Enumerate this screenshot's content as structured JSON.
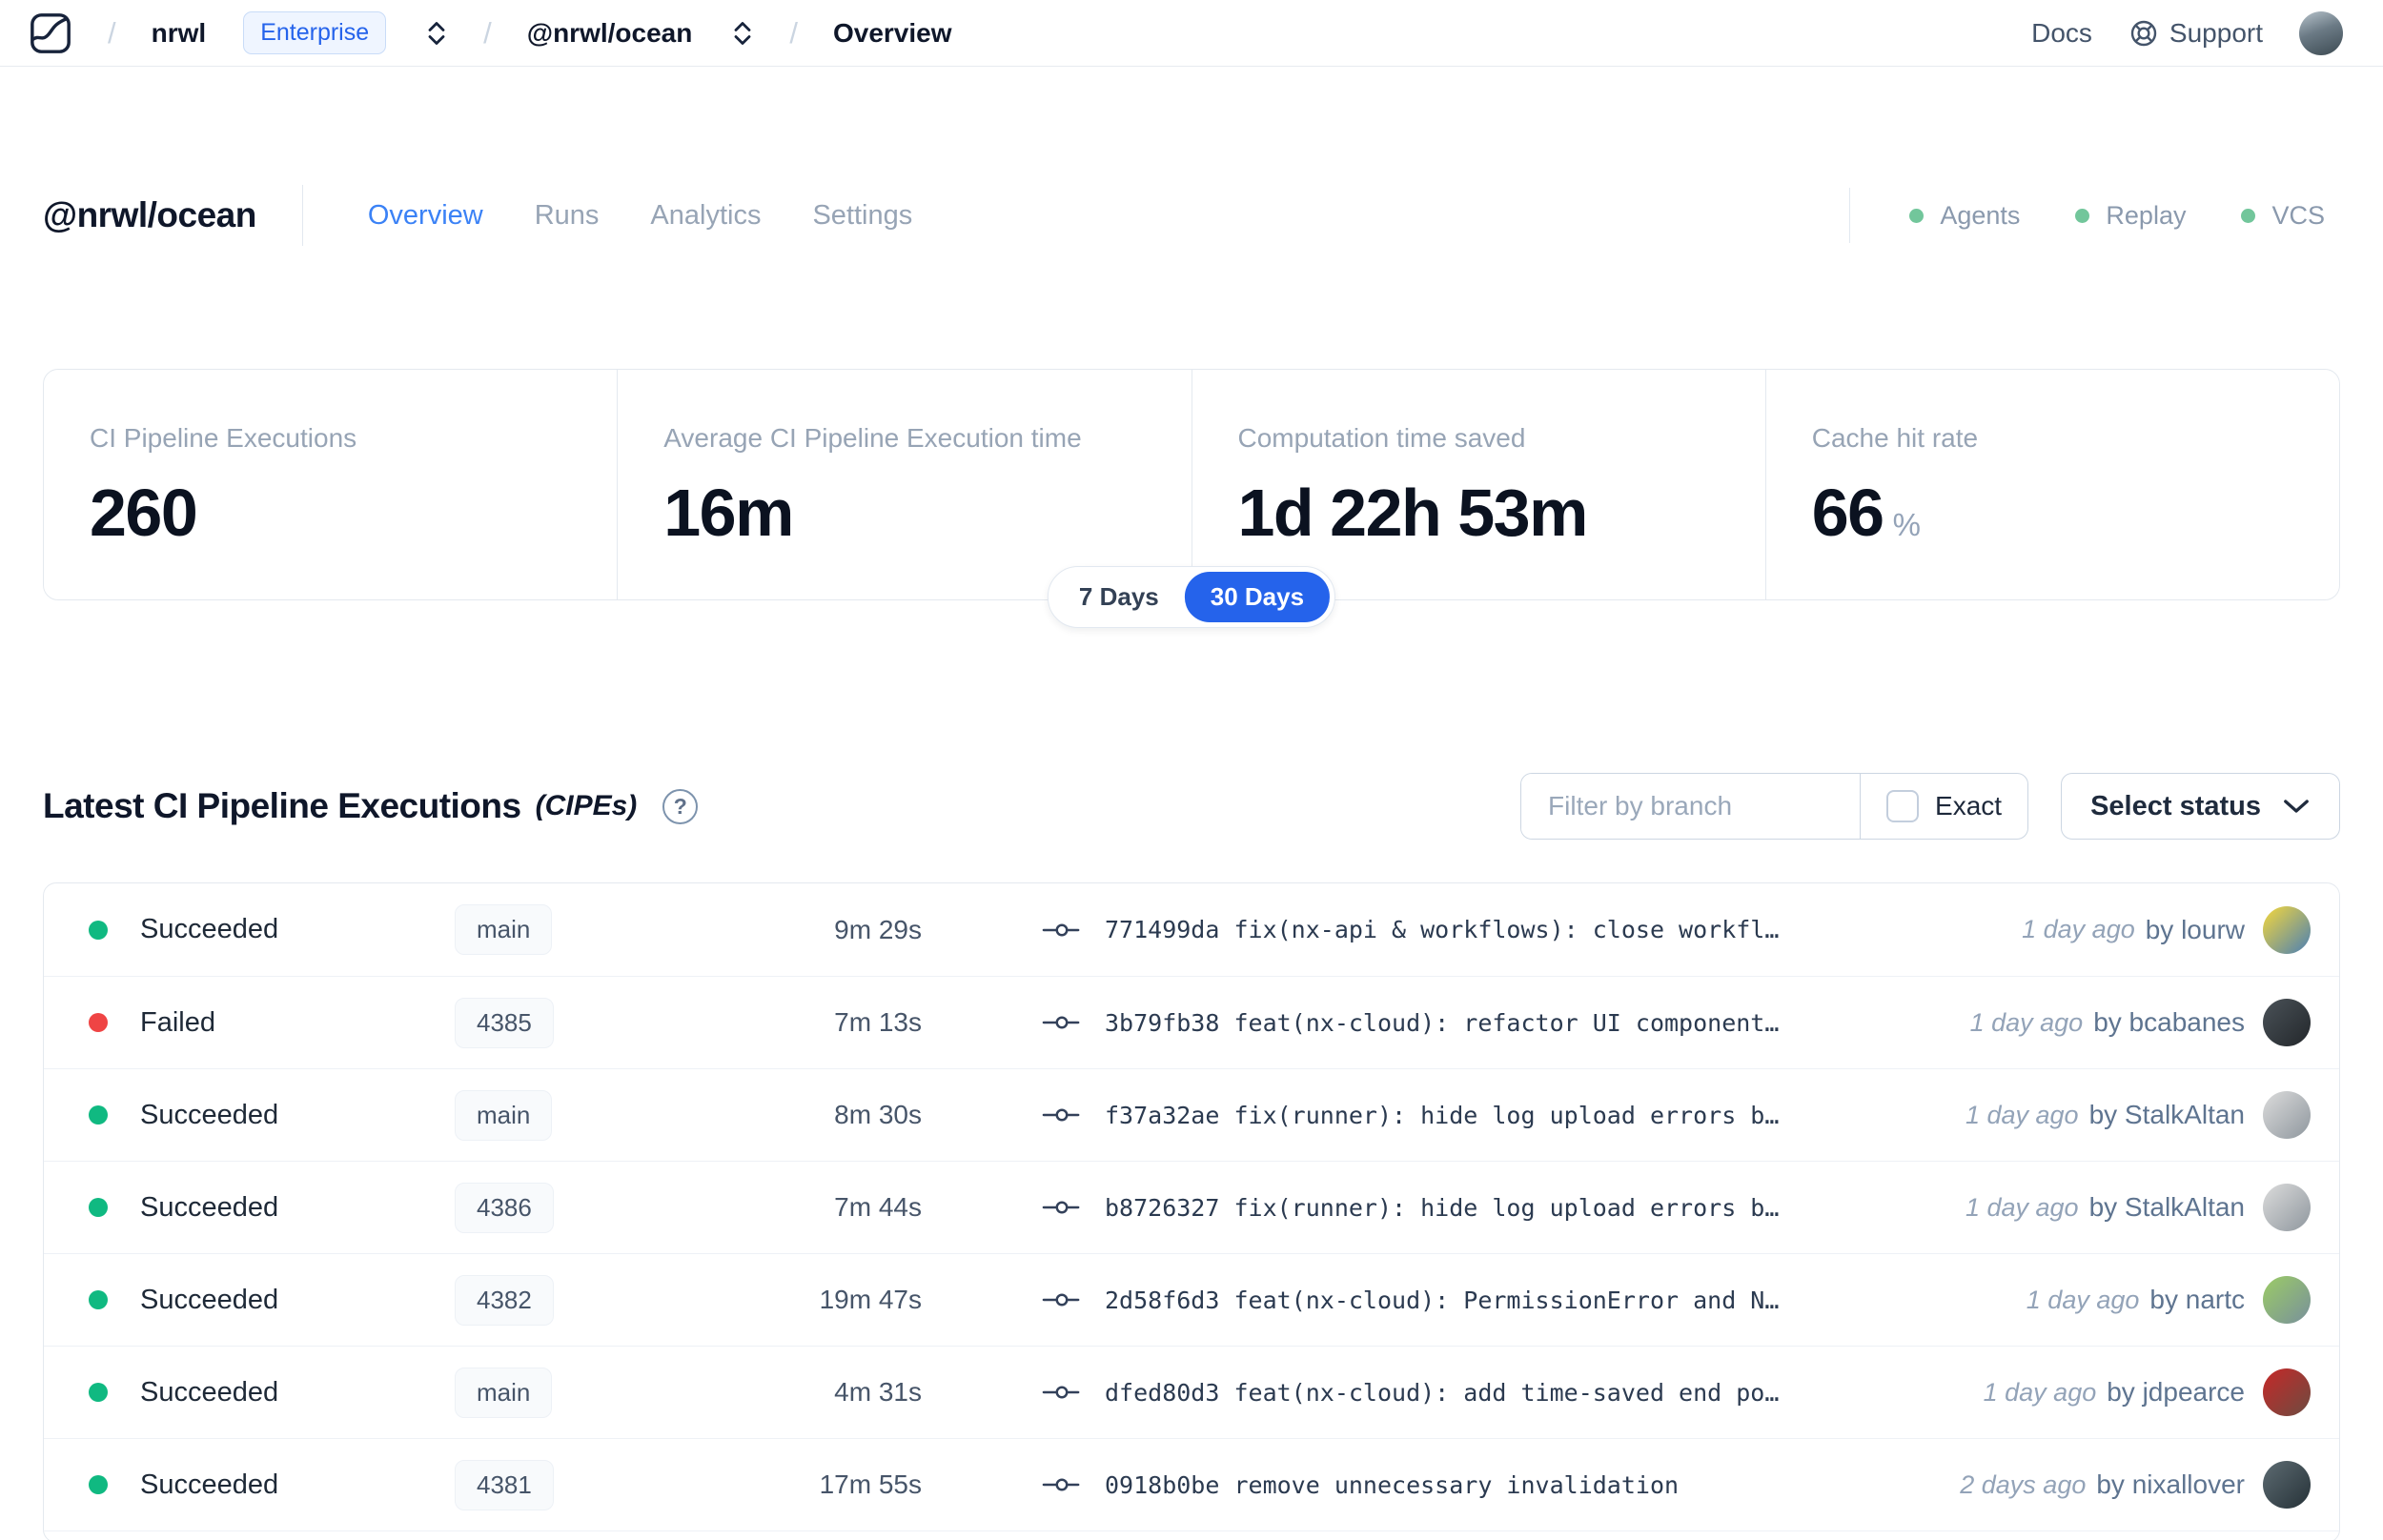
{
  "navbar": {
    "breadcrumb": {
      "separator": "/",
      "org": "nrwl",
      "org_badge": "Enterprise",
      "workspace": "@nrwl/ocean",
      "page": "Overview"
    },
    "docs_label": "Docs",
    "support_label": "Support"
  },
  "page_header": {
    "title": "@nrwl/ocean",
    "tabs": [
      {
        "label": "Overview",
        "active": true
      },
      {
        "label": "Runs",
        "active": false
      },
      {
        "label": "Analytics",
        "active": false
      },
      {
        "label": "Settings",
        "active": false
      }
    ],
    "feature_statuses": [
      {
        "label": "Agents",
        "color": "#72c69b"
      },
      {
        "label": "Replay",
        "color": "#72c69b"
      },
      {
        "label": "VCS",
        "color": "#72c69b"
      }
    ]
  },
  "stats": {
    "cards": [
      {
        "label": "CI Pipeline Executions",
        "value": "260",
        "unit": ""
      },
      {
        "label": "Average CI Pipeline Execution time",
        "value": "16m",
        "unit": ""
      },
      {
        "label": "Computation time saved",
        "value": "1d 22h 53m",
        "unit": ""
      },
      {
        "label": "Cache hit rate",
        "value": "66",
        "unit": "%"
      }
    ],
    "period_toggle": {
      "options": [
        "7 Days",
        "30 Days"
      ],
      "selected": "30 Days",
      "active_color": "#2563eb"
    }
  },
  "cipes": {
    "title": "Latest CI Pipeline Executions",
    "title_suffix": "(CIPEs)",
    "help_icon": "?",
    "filter": {
      "placeholder": "Filter by branch",
      "exact_label": "Exact",
      "checkbox_checked": false
    },
    "status_select_label": "Select status",
    "rows": [
      {
        "status": "Succeeded",
        "status_color": "#10b981",
        "branch": "main",
        "duration": "9m 29s",
        "commit": "771499da fix(nx-api & workflows): close workfl…",
        "time": "1 day ago",
        "author": "by lourw",
        "avatar_colors": [
          "#f6d83b",
          "#4a7fb5"
        ]
      },
      {
        "status": "Failed",
        "status_color": "#ef4444",
        "branch": "4385",
        "duration": "7m 13s",
        "commit": "3b79fb38 feat(nx-cloud): refactor UI component…",
        "time": "1 day ago",
        "author": "by bcabanes",
        "avatar_colors": [
          "#4a5258",
          "#23272b"
        ]
      },
      {
        "status": "Succeeded",
        "status_color": "#10b981",
        "branch": "main",
        "duration": "8m 30s",
        "commit": "f37a32ae fix(runner): hide log upload errors b…",
        "time": "1 day ago",
        "author": "by StalkAltan",
        "avatar_colors": [
          "#dcdcdc",
          "#8f979e"
        ]
      },
      {
        "status": "Succeeded",
        "status_color": "#10b981",
        "branch": "4386",
        "duration": "7m 44s",
        "commit": "b8726327 fix(runner): hide log upload errors b…",
        "time": "1 day ago",
        "author": "by StalkAltan",
        "avatar_colors": [
          "#dcdcdc",
          "#8f979e"
        ]
      },
      {
        "status": "Succeeded",
        "status_color": "#10b981",
        "branch": "4382",
        "duration": "19m 47s",
        "commit": "2d58f6d3 feat(nx-cloud): PermissionError and N…",
        "time": "1 day ago",
        "author": "by nartc",
        "avatar_colors": [
          "#9ccc65",
          "#78909c"
        ]
      },
      {
        "status": "Succeeded",
        "status_color": "#10b981",
        "branch": "main",
        "duration": "4m 31s",
        "commit": "dfed80d3 feat(nx-cloud): add time-saved end po…",
        "time": "1 day ago",
        "author": "by jdpearce",
        "avatar_colors": [
          "#c62828",
          "#6d4c41"
        ]
      },
      {
        "status": "Succeeded",
        "status_color": "#10b981",
        "branch": "4381",
        "duration": "17m 55s",
        "commit": "0918b0be remove unnecessary invalidation",
        "time": "2 days ago",
        "author": "by nixallover",
        "avatar_colors": [
          "#5d6b72",
          "#263238"
        ]
      }
    ]
  }
}
